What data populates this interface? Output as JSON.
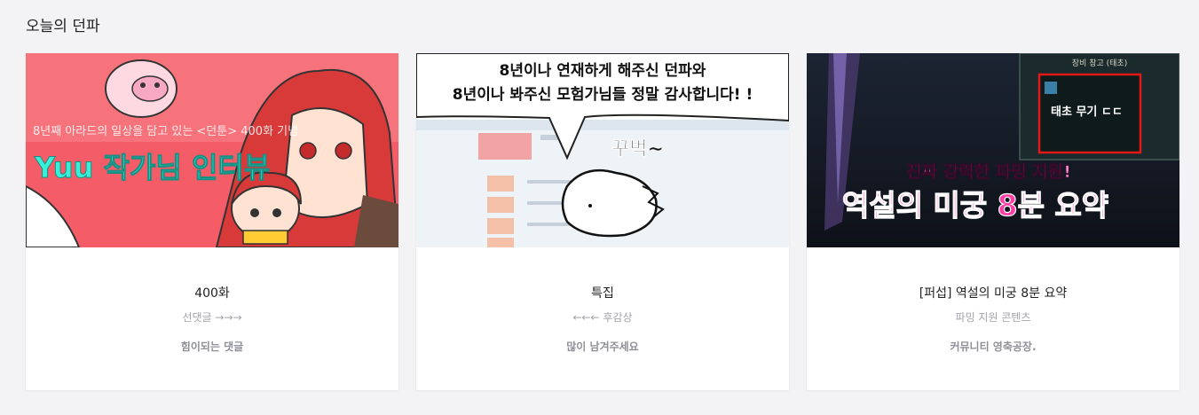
{
  "section": {
    "title": "오늘의 던파"
  },
  "cards": [
    {
      "thumb": {
        "caption": "8년째 아라드의 일상을 담고 있는 <던툰> 400화 기념",
        "headline": "Yuu 작가님 인터뷰"
      },
      "title": "400화",
      "subtitle": "선댓글 →→→",
      "description": "힘이되는 댓글"
    },
    {
      "thumb": {
        "line1": "8년이나 연재하게 해주신 던파와",
        "line2": "8년이나 봐주신 모험가님들 정말 감사합니다! !",
        "bubble": "꾸벅~"
      },
      "title": "특집",
      "subtitle": "←←← 후감상",
      "description": "많이 남겨주세요"
    },
    {
      "thumb": {
        "panel_title": "장비 창고 (태초)",
        "panel_item": "태초 무기 ㄷㄷ",
        "tagline": "진짜 강력한 파밍 지원!",
        "headline": "역설의 미궁 8분 요약"
      },
      "title": "[퍼섭] 역설의 미궁 8분 요약",
      "subtitle": "파밍 지원 콘텐츠",
      "description": "커뮤니티 영축공장."
    }
  ],
  "colors": {
    "card1_bg": "#f45c68",
    "card1_headline": "#38f0d8",
    "card3_headline": "#ff3da6"
  }
}
